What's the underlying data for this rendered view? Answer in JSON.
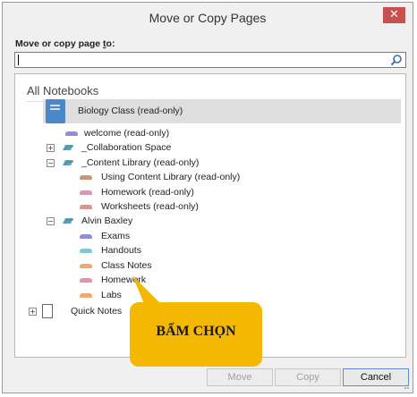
{
  "window": {
    "title": "Move or Copy Pages",
    "close_glyph": "✕"
  },
  "prompt": {
    "pre": "Move or copy page ",
    "accel": "t",
    "post": "o:"
  },
  "search": {
    "placeholder": "",
    "value": "",
    "icon": "search-icon"
  },
  "tree": {
    "header": "All Notebooks",
    "selected_notebook": "Biology Class (read-only)",
    "items": [
      {
        "label": "welcome (read-only)",
        "color": "#8f8fd8"
      },
      {
        "label": "_Collaboration Space",
        "expander": "+"
      },
      {
        "label": "_Content Library (read-only)",
        "expander": "−"
      },
      {
        "label": "Using Content Library (read-only)",
        "color": "#c8967a"
      },
      {
        "label": "Homework (read-only)",
        "color": "#e88fb5"
      },
      {
        "label": "Worksheets (read-only)",
        "color": "#e88f8f"
      },
      {
        "label": "Alvin Baxley",
        "expander": "−"
      },
      {
        "label": "Exams",
        "color": "#8f8fd8"
      },
      {
        "label": "Handouts",
        "color": "#7fc8d8"
      },
      {
        "label": "Class Notes",
        "color": "#f0a870"
      },
      {
        "label": "Homework",
        "color": "#e88fb5"
      },
      {
        "label": "Labs",
        "color": "#f0a870"
      }
    ],
    "quick_notes": {
      "label": "Quick Notes",
      "expander": "+"
    }
  },
  "buttons": {
    "move": "Move",
    "copy": "Copy",
    "cancel": "Cancel"
  },
  "callout": {
    "text": "BẤM CHỌN",
    "color": "#f5b800"
  }
}
